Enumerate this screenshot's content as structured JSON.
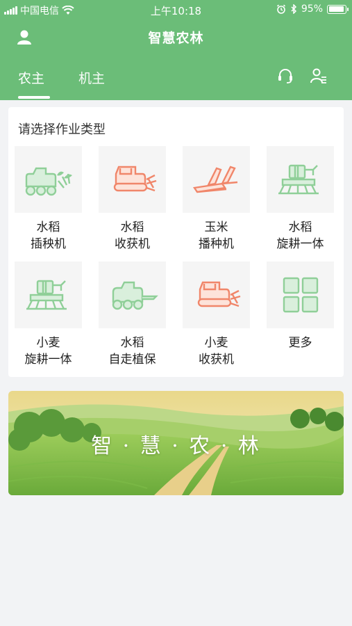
{
  "status_bar": {
    "carrier": "中国电信",
    "time": "上午10:18",
    "battery": "95%"
  },
  "header": {
    "title": "智慧农林",
    "tabs": [
      {
        "label": "农主",
        "active": true
      },
      {
        "label": "机主",
        "active": false
      }
    ],
    "icons": [
      "user-icon",
      "headset-icon",
      "person-list-icon"
    ]
  },
  "section": {
    "title": "请选择作业类型",
    "items": [
      {
        "line1": "水稻",
        "line2": "插秧机",
        "icon": "rice-transplanter-icon",
        "color": "green"
      },
      {
        "line1": "水稻",
        "line2": "收获机",
        "icon": "harvester-icon",
        "color": "orange"
      },
      {
        "line1": "玉米",
        "line2": "播种机",
        "icon": "seeder-icon",
        "color": "orange"
      },
      {
        "line1": "水稻",
        "line2": "旋耕一体",
        "icon": "rotary-tiller-icon",
        "color": "green"
      },
      {
        "line1": "小麦",
        "line2": "旋耕一体",
        "icon": "rotary-tiller-icon",
        "color": "green"
      },
      {
        "line1": "水稻",
        "line2": "自走植保",
        "icon": "sprayer-icon",
        "color": "green"
      },
      {
        "line1": "小麦",
        "line2": "收获机",
        "icon": "harvester-icon",
        "color": "orange"
      },
      {
        "line1": "更多",
        "line2": "",
        "icon": "grid-more-icon",
        "color": "green"
      }
    ]
  },
  "banner": {
    "text": "智 · 慧 · 农 · 林"
  },
  "colors": {
    "brand_green": "#6bbd78",
    "icon_green": "#8fcf98",
    "icon_orange": "#f0866a"
  }
}
